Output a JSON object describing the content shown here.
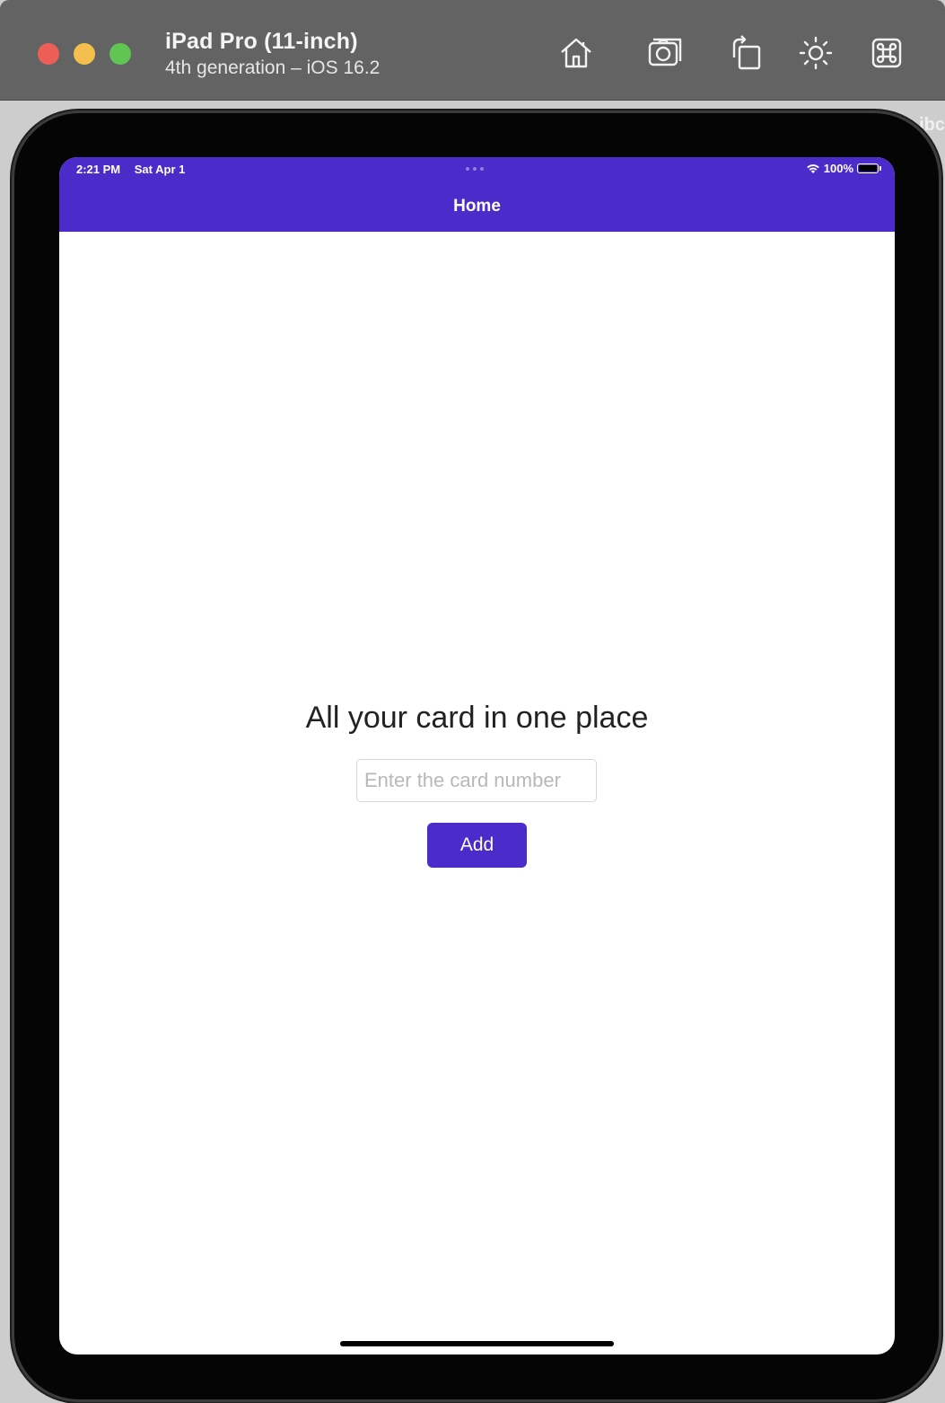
{
  "simulator": {
    "device_name": "iPad Pro (11-inch)",
    "device_subtitle": "4th generation – iOS 16.2",
    "toolbar_icons": [
      "home-icon",
      "screenshot-camera-icon",
      "rotate-icon",
      "appearance-sun-icon",
      "keyboard-command-icon"
    ],
    "background_peek_text": "ibc"
  },
  "status_bar": {
    "time": "2:21 PM",
    "date": "Sat Apr 1",
    "battery": "100%"
  },
  "nav": {
    "title": "Home",
    "color": "#4b2bca"
  },
  "main": {
    "headline": "All your card in one place",
    "card_input": {
      "value": "",
      "placeholder": "Enter the card number"
    },
    "add_button_label": "Add"
  }
}
